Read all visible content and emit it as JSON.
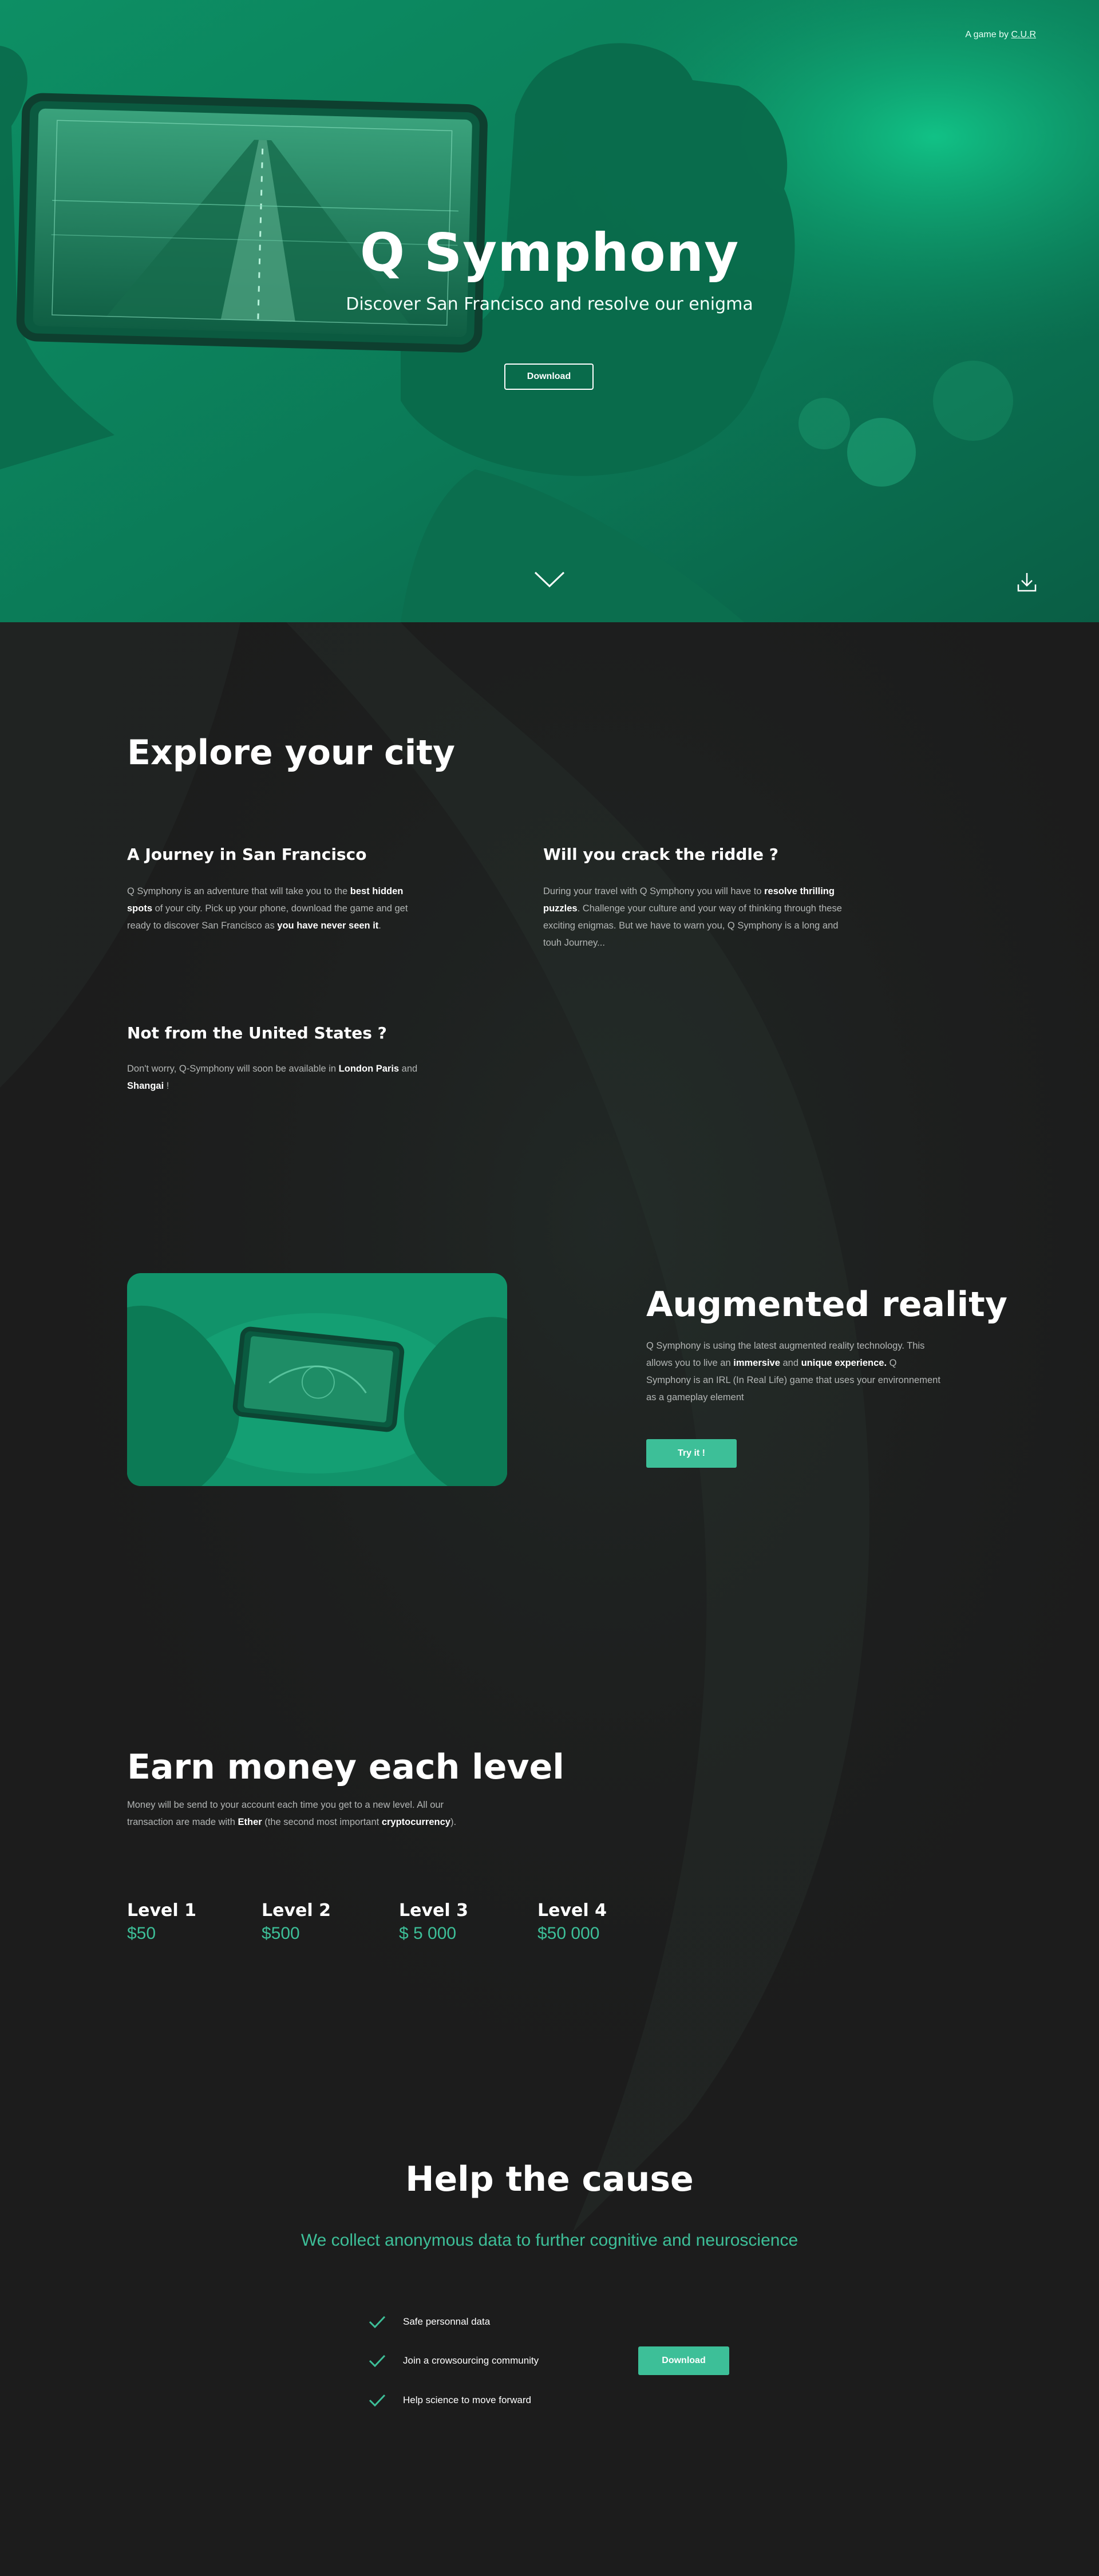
{
  "colors": {
    "accent": "#3dbf98",
    "hero_green": "#0d8f64",
    "background": "#1c1c1c"
  },
  "hero": {
    "credit_prefix": "A game by ",
    "credit_link": "C.U.R",
    "title": "Q Symphony",
    "subtitle": "Discover San Francisco and resolve our enigma",
    "download_label": "Download",
    "scroll_icon": "chevron-down-icon",
    "corner_icon": "download-icon"
  },
  "explore": {
    "title": "Explore your city",
    "blocks": [
      {
        "title": "A Journey in San Francisco",
        "text": [
          {
            "t": "Q Symphony is an adventure that will take you to the "
          },
          {
            "t": "best hidden spots",
            "b": true
          },
          {
            "t": " of your city. Pick up your phone, download the game and get ready to discover San Francisco as "
          },
          {
            "t": "you have never seen it",
            "b": true
          },
          {
            "t": "."
          }
        ]
      },
      {
        "title": "Will you crack the riddle ?",
        "text": [
          {
            "t": "During your travel with Q Symphony you will have to "
          },
          {
            "t": "resolve thrilling puzzles",
            "b": true
          },
          {
            "t": ". Challenge your culture and your way of thinking through these exciting enigmas. But we have to warn you, Q Symphony is a long and touh Journey..."
          }
        ]
      },
      {
        "title": "Not from the United States ?",
        "text": [
          {
            "t": "Don't worry, Q-Symphony will soon be available in "
          },
          {
            "t": "London Paris",
            "b": true
          },
          {
            "t": " and "
          },
          {
            "t": "Shangai",
            "b": true
          },
          {
            "t": " !"
          }
        ]
      }
    ]
  },
  "ar": {
    "title": "Augmented reality",
    "text": [
      {
        "t": "Q Symphony is using the latest augmented reality technology. This allows you to live an "
      },
      {
        "t": "immersive",
        "b": true
      },
      {
        "t": " and "
      },
      {
        "t": "unique experience.",
        "b": true
      },
      {
        "t": " Q Symphony is an IRL (In Real Life) game that uses your environnement as a gameplay element"
      }
    ],
    "button_label": "Try it !"
  },
  "money": {
    "title": "Earn money each level",
    "text": [
      {
        "t": "Money will be send to your account each time you get to a new level. All our transaction are made with "
      },
      {
        "t": "Ether",
        "b": true
      },
      {
        "t": " (the second most important "
      },
      {
        "t": "cryptocurrency",
        "b": true
      },
      {
        "t": ")."
      }
    ],
    "levels": [
      {
        "name": "Level 1",
        "value": "$50"
      },
      {
        "name": "Level 2",
        "value": "$500"
      },
      {
        "name": "Level 3",
        "value": "$ 5 000"
      },
      {
        "name": "Level 4",
        "value": "$50 000"
      }
    ]
  },
  "help": {
    "title": "Help the cause",
    "subtitle": "We collect anonymous data  to further cognitive and neuroscience",
    "features": [
      "Safe personnal data",
      "Join a crowsourcing community",
      "Help science to move forward"
    ],
    "button_label": "Download",
    "check_icon": "check-icon"
  }
}
